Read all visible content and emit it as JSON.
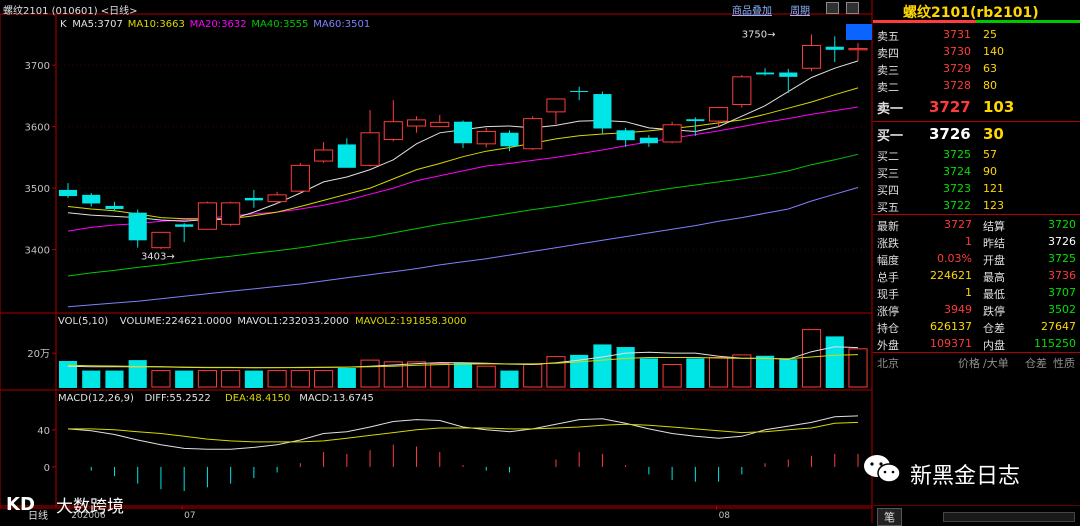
{
  "window": {
    "title": "螺纹2101 (010601) <日线>",
    "links": {
      "overlay": "商品叠加",
      "period": "周期"
    }
  },
  "colors": {
    "up": "#ff3b3b",
    "down": "#00e5e5",
    "ma5": "#e0e0e0",
    "ma10": "#d8d800",
    "ma20": "#ff00ff",
    "ma40": "#00c800",
    "ma60": "#8080ff",
    "axis": "#b00000"
  },
  "price_panel": {
    "legend": [
      {
        "key": "K",
        "label": "K"
      },
      {
        "key": "ma5",
        "label": "MA5:3707"
      },
      {
        "key": "ma10",
        "label": "MA10:3663"
      },
      {
        "key": "ma20",
        "label": "MA20:3632"
      },
      {
        "key": "ma40",
        "label": "MA40:3555"
      },
      {
        "key": "ma60",
        "label": "MA60:3501"
      }
    ],
    "y_ticks": [
      "3700",
      "3600",
      "3500",
      "3400"
    ],
    "annotations": {
      "high": "3750",
      "low": "3403"
    }
  },
  "volume_panel": {
    "legend": [
      {
        "key": "vol",
        "label": "VOL(5,10)"
      },
      {
        "key": "volume",
        "label": "VOLUME:224621.0000"
      },
      {
        "key": "mavol1",
        "label": "MAVOL1:232033.2000"
      },
      {
        "key": "mavol2",
        "label": "MAVOL2:191858.3000"
      }
    ],
    "y_ticks": [
      "20万"
    ]
  },
  "macd_panel": {
    "legend": [
      {
        "key": "macd",
        "label": "MACD(12,26,9)"
      },
      {
        "key": "diff",
        "label": "DIFF:55.2522"
      },
      {
        "key": "dea",
        "label": "DEA:48.4150"
      },
      {
        "key": "m",
        "label": "MACD:13.6745"
      }
    ],
    "y_ticks": [
      "40",
      "0"
    ]
  },
  "x_axis": {
    "period_label": "日线",
    "labels": [
      "202006",
      "07",
      "08"
    ]
  },
  "quote_panel": {
    "title": "螺纹2101(rb2101)",
    "asks": [
      {
        "label": "卖五",
        "price": "3731",
        "vol": "25"
      },
      {
        "label": "卖四",
        "price": "3730",
        "vol": "140"
      },
      {
        "label": "卖三",
        "price": "3729",
        "vol": "63"
      },
      {
        "label": "卖二",
        "price": "3728",
        "vol": "80"
      },
      {
        "label": "卖一",
        "price": "3727",
        "vol": "103"
      }
    ],
    "bids": [
      {
        "label": "买一",
        "price": "3726",
        "vol": "30"
      },
      {
        "label": "买二",
        "price": "3725",
        "vol": "57"
      },
      {
        "label": "买三",
        "price": "3724",
        "vol": "90"
      },
      {
        "label": "买四",
        "price": "3723",
        "vol": "121"
      },
      {
        "label": "买五",
        "price": "3722",
        "vol": "123"
      }
    ],
    "stats": [
      {
        "l1": "最新",
        "v1": "3727",
        "c1": "up",
        "l2": "结算",
        "v2": "3720",
        "c2": "green"
      },
      {
        "l1": "涨跌",
        "v1": "1",
        "c1": "up",
        "l2": "昨结",
        "v2": "3726",
        "c2": "white"
      },
      {
        "l1": "幅度",
        "v1": "0.03%",
        "c1": "up",
        "l2": "开盘",
        "v2": "3725",
        "c2": "green"
      },
      {
        "l1": "总手",
        "v1": "224621",
        "c1": "yellow",
        "l2": "最高",
        "v2": "3736",
        "c2": "up"
      },
      {
        "l1": "现手",
        "v1": "1",
        "c1": "yellow",
        "l2": "最低",
        "v2": "3707",
        "c2": "green"
      },
      {
        "l1": "涨停",
        "v1": "3949",
        "c1": "up",
        "l2": "跌停",
        "v2": "3502",
        "c2": "green"
      },
      {
        "l1": "持仓",
        "v1": "626137",
        "c1": "yellow",
        "l2": "仓差",
        "v2": "27647",
        "c2": "yellow"
      },
      {
        "l1": "外盘",
        "v1": "109371",
        "c1": "up",
        "l2": "内盘",
        "v2": "115250",
        "c2": "green"
      }
    ],
    "tick_header": {
      "city": "北京",
      "price": "价格",
      "vol": "∕大单",
      "pos": "仓差",
      "nature": "性质"
    },
    "footer_tab": "笔"
  },
  "watermarks": {
    "wechat": "新黑金日志",
    "logo": "大数跨境"
  },
  "chart_data": {
    "type": "candlestick",
    "price_ylim": [
      3300,
      3780
    ],
    "candles": [
      {
        "o": 3497,
        "h": 3508,
        "l": 3484,
        "c": 3487
      },
      {
        "o": 3489,
        "h": 3492,
        "l": 3470,
        "c": 3475
      },
      {
        "o": 3471,
        "h": 3478,
        "l": 3462,
        "c": 3466
      },
      {
        "o": 3460,
        "h": 3465,
        "l": 3403,
        "c": 3415
      },
      {
        "o": 3403,
        "h": 3428,
        "l": 3401,
        "c": 3428
      },
      {
        "o": 3441,
        "h": 3443,
        "l": 3412,
        "c": 3437
      },
      {
        "o": 3433,
        "h": 3478,
        "l": 3433,
        "c": 3476
      },
      {
        "o": 3441,
        "h": 3478,
        "l": 3438,
        "c": 3476
      },
      {
        "o": 3484,
        "h": 3497,
        "l": 3468,
        "c": 3480
      },
      {
        "o": 3478,
        "h": 3494,
        "l": 3475,
        "c": 3489
      },
      {
        "o": 3495,
        "h": 3541,
        "l": 3492,
        "c": 3537
      },
      {
        "o": 3544,
        "h": 3575,
        "l": 3541,
        "c": 3562
      },
      {
        "o": 3571,
        "h": 3581,
        "l": 3554,
        "c": 3533
      },
      {
        "o": 3537,
        "h": 3627,
        "l": 3535,
        "c": 3590
      },
      {
        "o": 3579,
        "h": 3643,
        "l": 3576,
        "c": 3608
      },
      {
        "o": 3601,
        "h": 3617,
        "l": 3590,
        "c": 3611
      },
      {
        "o": 3600,
        "h": 3619,
        "l": 3599,
        "c": 3607
      },
      {
        "o": 3608,
        "h": 3610,
        "l": 3565,
        "c": 3573
      },
      {
        "o": 3572,
        "h": 3598,
        "l": 3566,
        "c": 3592
      },
      {
        "o": 3590,
        "h": 3594,
        "l": 3560,
        "c": 3568
      },
      {
        "o": 3564,
        "h": 3617,
        "l": 3562,
        "c": 3613
      },
      {
        "o": 3624,
        "h": 3645,
        "l": 3604,
        "c": 3645
      },
      {
        "o": 3658,
        "h": 3665,
        "l": 3643,
        "c": 3657
      },
      {
        "o": 3653,
        "h": 3657,
        "l": 3589,
        "c": 3597
      },
      {
        "o": 3594,
        "h": 3598,
        "l": 3567,
        "c": 3578
      },
      {
        "o": 3582,
        "h": 3586,
        "l": 3567,
        "c": 3573
      },
      {
        "o": 3575,
        "h": 3608,
        "l": 3573,
        "c": 3603
      },
      {
        "o": 3612,
        "h": 3615,
        "l": 3585,
        "c": 3609
      },
      {
        "o": 3609,
        "h": 3631,
        "l": 3600,
        "c": 3631
      },
      {
        "o": 3636,
        "h": 3684,
        "l": 3631,
        "c": 3681
      },
      {
        "o": 3688,
        "h": 3695,
        "l": 3683,
        "c": 3685
      },
      {
        "o": 3688,
        "h": 3694,
        "l": 3655,
        "c": 3681
      },
      {
        "o": 3695,
        "h": 3750,
        "l": 3690,
        "c": 3732
      },
      {
        "o": 3730,
        "h": 3747,
        "l": 3705,
        "c": 3725
      },
      {
        "o": 3725,
        "h": 3736,
        "l": 3707,
        "c": 3727
      }
    ],
    "ma5": [
      3460,
      3456,
      3454,
      3452,
      3448,
      3446,
      3449,
      3449,
      3461,
      3475,
      3492,
      3510,
      3518,
      3530,
      3546,
      3572,
      3590,
      3595,
      3600,
      3601,
      3598,
      3602,
      3609,
      3610,
      3608,
      3598,
      3595,
      3592,
      3600,
      3617,
      3634,
      3657,
      3680,
      3695,
      3707
    ],
    "ma10": [
      3470,
      3466,
      3463,
      3458,
      3452,
      3450,
      3450,
      3450,
      3455,
      3461,
      3470,
      3480,
      3490,
      3500,
      3515,
      3530,
      3540,
      3551,
      3560,
      3566,
      3573,
      3580,
      3585,
      3588,
      3590,
      3593,
      3597,
      3601,
      3606,
      3611,
      3620,
      3630,
      3640,
      3652,
      3663
    ],
    "ma20": [
      3430,
      3436,
      3440,
      3442,
      3446,
      3448,
      3451,
      3455,
      3458,
      3461,
      3466,
      3472,
      3480,
      3490,
      3500,
      3512,
      3520,
      3528,
      3536,
      3540,
      3545,
      3550,
      3556,
      3562,
      3569,
      3575,
      3581,
      3587,
      3593,
      3600,
      3607,
      3613,
      3620,
      3626,
      3632
    ],
    "ma40": [
      3357,
      3362,
      3366,
      3371,
      3375,
      3380,
      3385,
      3389,
      3394,
      3398,
      3403,
      3409,
      3415,
      3420,
      3427,
      3434,
      3441,
      3447,
      3453,
      3459,
      3465,
      3470,
      3476,
      3482,
      3488,
      3494,
      3500,
      3505,
      3510,
      3515,
      3521,
      3528,
      3538,
      3546,
      3555
    ],
    "ma60": [
      3307,
      3310,
      3313,
      3316,
      3320,
      3324,
      3328,
      3332,
      3336,
      3340,
      3344,
      3349,
      3354,
      3359,
      3364,
      3369,
      3375,
      3380,
      3385,
      3391,
      3397,
      3403,
      3409,
      3415,
      3421,
      3427,
      3433,
      3439,
      3446,
      3452,
      3459,
      3466,
      3479,
      3490,
      3501
    ],
    "volume_ylim": [
      0,
      350000
    ],
    "volume": [
      155000,
      100000,
      100000,
      160000,
      100000,
      100000,
      100000,
      100000,
      100000,
      100000,
      100000,
      100000,
      115000,
      160000,
      150000,
      150000,
      140000,
      145000,
      125000,
      100000,
      135000,
      180000,
      190000,
      250000,
      235000,
      170000,
      135000,
      170000,
      175000,
      190000,
      185000,
      165000,
      335000,
      296000,
      224621
    ],
    "mavol1": [
      125000,
      122000,
      122000,
      122000,
      121000,
      118000,
      117000,
      117000,
      116000,
      117000,
      117000,
      118000,
      120000,
      125000,
      132000,
      140000,
      146000,
      145000,
      142000,
      137000,
      135000,
      145000,
      160000,
      178000,
      200000,
      205000,
      200000,
      200000,
      182000,
      171000,
      171000,
      165000,
      208000,
      237000,
      232033
    ],
    "mavol2": [
      130000,
      128000,
      126000,
      124000,
      123000,
      120000,
      118000,
      118000,
      117000,
      117000,
      118000,
      119000,
      120000,
      122000,
      125000,
      130000,
      134000,
      137000,
      138000,
      138000,
      138000,
      142000,
      150000,
      160000,
      170000,
      175000,
      175000,
      175000,
      172000,
      170000,
      170000,
      168000,
      178000,
      188000,
      191858
    ],
    "macd_ylim": [
      -40,
      70
    ],
    "diff": [
      41,
      39,
      35,
      29,
      24,
      20,
      19,
      19,
      21,
      24,
      29,
      36,
      38,
      43,
      49,
      51,
      50,
      43,
      40,
      38,
      41,
      46,
      51,
      52,
      47,
      41,
      36,
      33,
      31,
      33,
      40,
      44,
      48,
      54,
      55
    ],
    "dea": [
      41,
      41,
      40,
      38,
      36,
      33,
      30,
      28,
      27,
      27,
      27,
      28,
      31,
      34,
      37,
      40,
      42,
      42,
      42,
      41,
      41,
      42,
      43,
      45,
      46,
      45,
      43,
      41,
      39,
      37,
      38,
      40,
      42,
      47,
      48
    ],
    "macd": [
      0,
      -4,
      -10,
      -18,
      -24,
      -26,
      -22,
      -18,
      -12,
      -6,
      4,
      16,
      14,
      18,
      24,
      22,
      16,
      2,
      -4,
      -6,
      0,
      8,
      16,
      14,
      2,
      -8,
      -14,
      -16,
      -16,
      -8,
      4,
      8,
      12,
      14,
      14
    ]
  }
}
